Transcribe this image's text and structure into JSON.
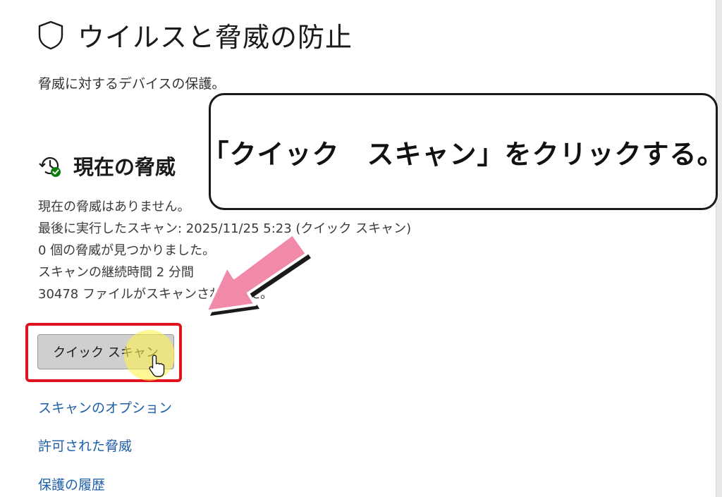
{
  "header": {
    "title": "ウイルスと脅威の防止",
    "subtitle": "脅威に対するデバイスの保護。",
    "icon": "shield-icon"
  },
  "current_threats": {
    "title": "現在の脅威",
    "icon": "history-icon",
    "lines": [
      "現在の脅威はありません。",
      "最後に実行したスキャン: 2025/11/25 5:23 (クイック スキャン)",
      "0 個の脅威が見つかりました。",
      "スキャンの継続時間 2 分間",
      "30478 ファイルがスキャンされました。"
    ],
    "quick_scan_button": "クイック スキャン"
  },
  "links": [
    "スキャンのオプション",
    "許可された脅威",
    "保護の履歴"
  ],
  "annotation": {
    "callout_text": "「クイック　スキャン」をクリックする。",
    "arrow_color": "#f08aa8",
    "highlight_color": "#e0141e"
  },
  "colors": {
    "link": "#1f5fa8",
    "button_bg": "#cfcfcf"
  }
}
